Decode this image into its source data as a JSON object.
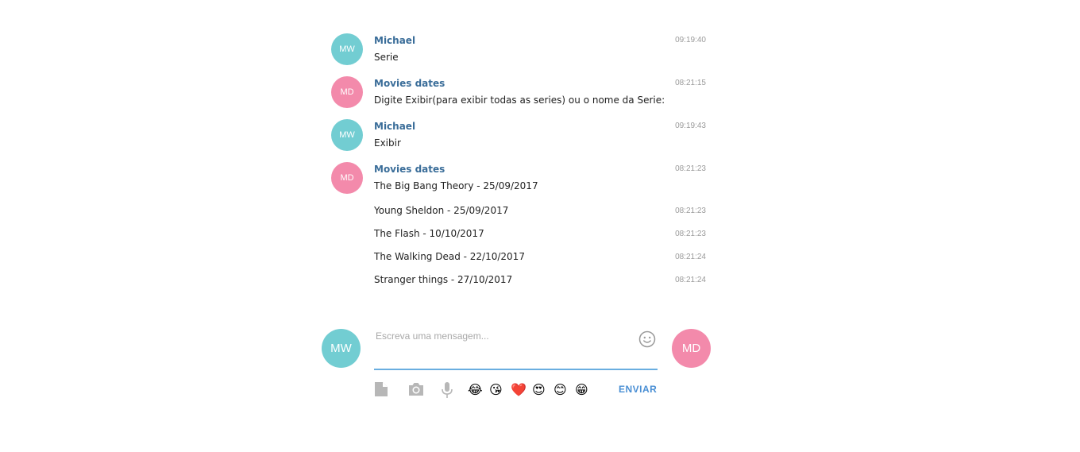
{
  "messages": [
    {
      "avatar": "MW",
      "sender": "Michael",
      "text": "Serie",
      "time": "09:19:40"
    },
    {
      "avatar": "MD",
      "sender": "Movies dates",
      "text": "Digite Exibir(para exibir todas as series) ou o nome da Serie:",
      "time": "08:21:15"
    },
    {
      "avatar": "MW",
      "sender": "Michael",
      "text": "Exibir",
      "time": "09:19:43"
    },
    {
      "avatar": "MD",
      "sender": "Movies dates",
      "text": "The Big Bang Theory - 25/09/2017",
      "time": "08:21:23"
    }
  ],
  "followups": [
    {
      "text": "Young Sheldon - 25/09/2017",
      "time": "08:21:23"
    },
    {
      "text": "The Flash - 10/10/2017",
      "time": "08:21:23"
    },
    {
      "text": "The Walking Dead - 22/10/2017",
      "time": "08:21:24"
    },
    {
      "text": "Stranger things - 27/10/2017",
      "time": "08:21:24"
    }
  ],
  "composer": {
    "user_avatar": "MW",
    "bot_avatar": "MD",
    "placeholder": "Escreva uma mensagem...",
    "value": "",
    "send_label": "ENVIAR",
    "quick_emojis": [
      "😂",
      "😘",
      "❤️",
      "😍",
      "😊",
      "😁"
    ]
  },
  "colors": {
    "user_avatar": "#72cdd2",
    "bot_avatar": "#f38aab",
    "sender_name": "#3a6d99",
    "accent": "#4a8fd4"
  }
}
